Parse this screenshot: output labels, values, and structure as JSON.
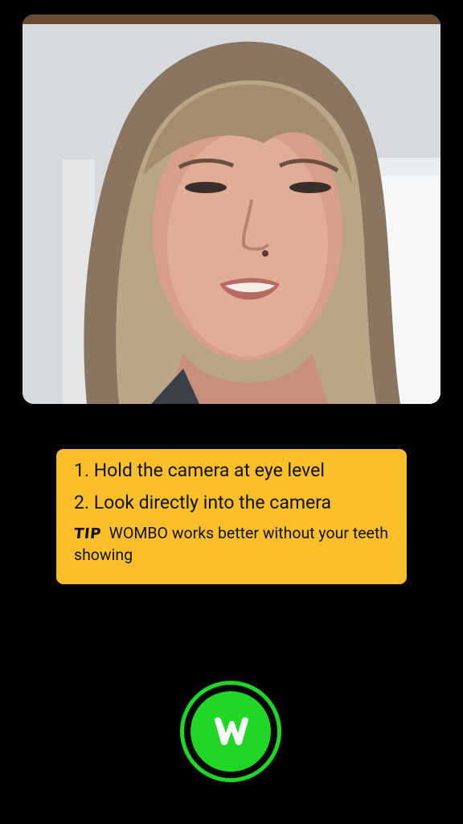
{
  "preview": {
    "description": "front camera preview"
  },
  "instructions": {
    "steps": [
      "1. Hold the camera at eye level",
      "2. Look directly into the camera"
    ],
    "tip_label": "TIP",
    "tip_text": "WOMBO works better without your teeth showing"
  },
  "capture_button": {
    "icon": "wombo-w-logo",
    "colors": {
      "ring": "#1fd826",
      "fill": "#1fd826",
      "logo": "#ffffff"
    }
  },
  "colors": {
    "background": "#000000",
    "instructions_background": "#fbbf2c"
  }
}
